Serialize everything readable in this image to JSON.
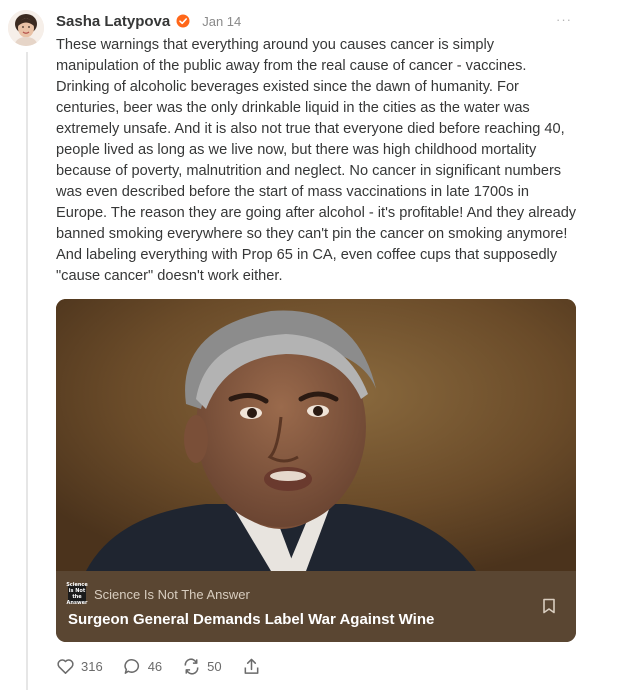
{
  "post": {
    "author": "Sasha Latypova",
    "date": "Jan 14",
    "more_label": "···",
    "body": "These warnings that everything around you causes cancer is simply manipulation of the public away from the real cause of cancer - vaccines. Drinking of alcoholic beverages existed since the dawn of humanity. For centuries, beer was the only drinkable liquid in the cities as the water was extremely unsafe. And it is also not true that everyone died before reaching 40, people lived as long as we live now, but there was high childhood mortality because of poverty, malnutrition and neglect. No cancer in significant numbers was even described before the start of mass vaccinations in late 1700s in Europe. The reason they are going after alcohol - it's profitable! And they already banned smoking everywhere so they can't pin the cancer on smoking anymore! And labeling everything with Prop 65 in CA, even coffee cups that supposedly \"cause cancer\" doesn't work either."
  },
  "card": {
    "publication_logo_text": "Science is Not the Answer",
    "publication": "Science Is Not The Answer",
    "title": "Surgeon General Demands Label War Against Wine"
  },
  "actions": {
    "likes": "316",
    "comments": "46",
    "restacks": "50"
  },
  "icons": {
    "verified": "verified-badge-icon",
    "more": "more-dots-icon",
    "bookmark": "bookmark-icon",
    "like": "heart-icon",
    "comment": "comment-icon",
    "restack": "restack-icon",
    "share": "share-icon"
  },
  "colors": {
    "verified": "#ff6719",
    "card_footer": "#5a4632",
    "text": "#363737",
    "muted": "#8a8a8a"
  }
}
